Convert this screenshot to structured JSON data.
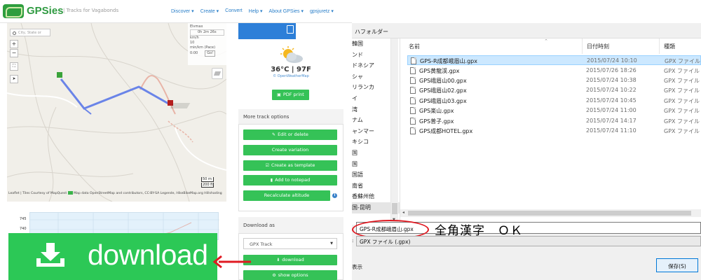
{
  "header": {
    "brand": "GPSies",
    "tagline": "| Tracks for Vagabonds",
    "nav": [
      "Discover ▾",
      "Create ▾",
      "Convert",
      "Help ▾",
      "About GPSies ▾",
      "gpsjuretz ▾"
    ]
  },
  "map": {
    "search_placeholder": "City, State or",
    "zoom_in": "+",
    "zoom_out": "−",
    "stats": [
      "Elvmax",
      "0h 2m 26s",
      "km/h",
      "10",
      "min/km (Pace)"
    ],
    "stats_value": "0:00",
    "go_label": "Go!",
    "scale_m": "50 m",
    "scale_ft": "200 ft",
    "attribution": "Leaflet | Tiles Courtesy of MapQuest",
    "attribution_rest": "Map data OpenStreetMap and contributors, CC-BY-SA Legende, HikeBikeMap.org Hillshading"
  },
  "elevation": {
    "ticks": [
      "745",
      "740"
    ]
  },
  "weather": {
    "temp": "36°C | 97F",
    "source": "© OpenWeatherMap"
  },
  "buttons": {
    "pdf_print": "PDF print",
    "edit_delete": "Edit or delete",
    "create_variation": "Create variation",
    "create_template": "Create as template",
    "add_notepad": "Add to notepad",
    "recalc_altitude": "Recalculate altitude",
    "download": "download",
    "show_options": "show options"
  },
  "more_options": {
    "title": "More track options"
  },
  "download_panel": {
    "title": "Download as",
    "format": "GPX Track"
  },
  "big_download": {
    "label": "download"
  },
  "dialog": {
    "title": "ハフォルダー",
    "nav_items": [
      "韓国",
      "ンド",
      "ドネシア",
      "シャ",
      "リランカ",
      "イ",
      "湾",
      "ナム",
      "ャンマー",
      "キシコ",
      "国",
      "国",
      "国語",
      "南省",
      "香蘇州他",
      "国-昆明"
    ],
    "nav_selected_index": 15,
    "columns": [
      "名前",
      "日付時刻",
      "種類"
    ],
    "files": [
      {
        "name": "GPS-R成都峨眉山.gpx",
        "date": "2015/07/24 10:10",
        "type": "GPX ファイル",
        "selected": true
      },
      {
        "name": "GPS黄龍渓.gpx",
        "date": "2015/07/26 18:26",
        "type": "GPX ファイル",
        "selected": false
      },
      {
        "name": "GPS峨眉山00.gpx",
        "date": "2015/07/24 10:38",
        "type": "GPX ファイル",
        "selected": false
      },
      {
        "name": "GPS峨眉山02.gpx",
        "date": "2015/07/24 10:22",
        "type": "GPX ファイル",
        "selected": false
      },
      {
        "name": "GPS峨眉山03.gpx",
        "date": "2015/07/24 10:45",
        "type": "GPX ファイル",
        "selected": false
      },
      {
        "name": "GPS楽山.gpx",
        "date": "2015/07/24 11:00",
        "type": "GPX ファイル",
        "selected": false
      },
      {
        "name": "GPS普子.gpx",
        "date": "2015/07/24 14:17",
        "type": "GPX ファイル",
        "selected": false
      },
      {
        "name": "GPS成都HOTEL.gpx",
        "date": "2015/07/24 11:10",
        "type": "GPX ファイル",
        "selected": false
      }
    ],
    "filename_value": "GPS-R成都峨眉山.gpx",
    "annotation": "全角漢字　ＯＫ",
    "filetype_label": ":",
    "filetype_value": "GPX ファイル (.gpx)",
    "hide_folders": "表示",
    "save_label": "保存(S)"
  },
  "colors": {
    "green": "#35c257",
    "blue": "#2d7fd8",
    "red": "#e01a22",
    "selection": "#cce8ff"
  }
}
